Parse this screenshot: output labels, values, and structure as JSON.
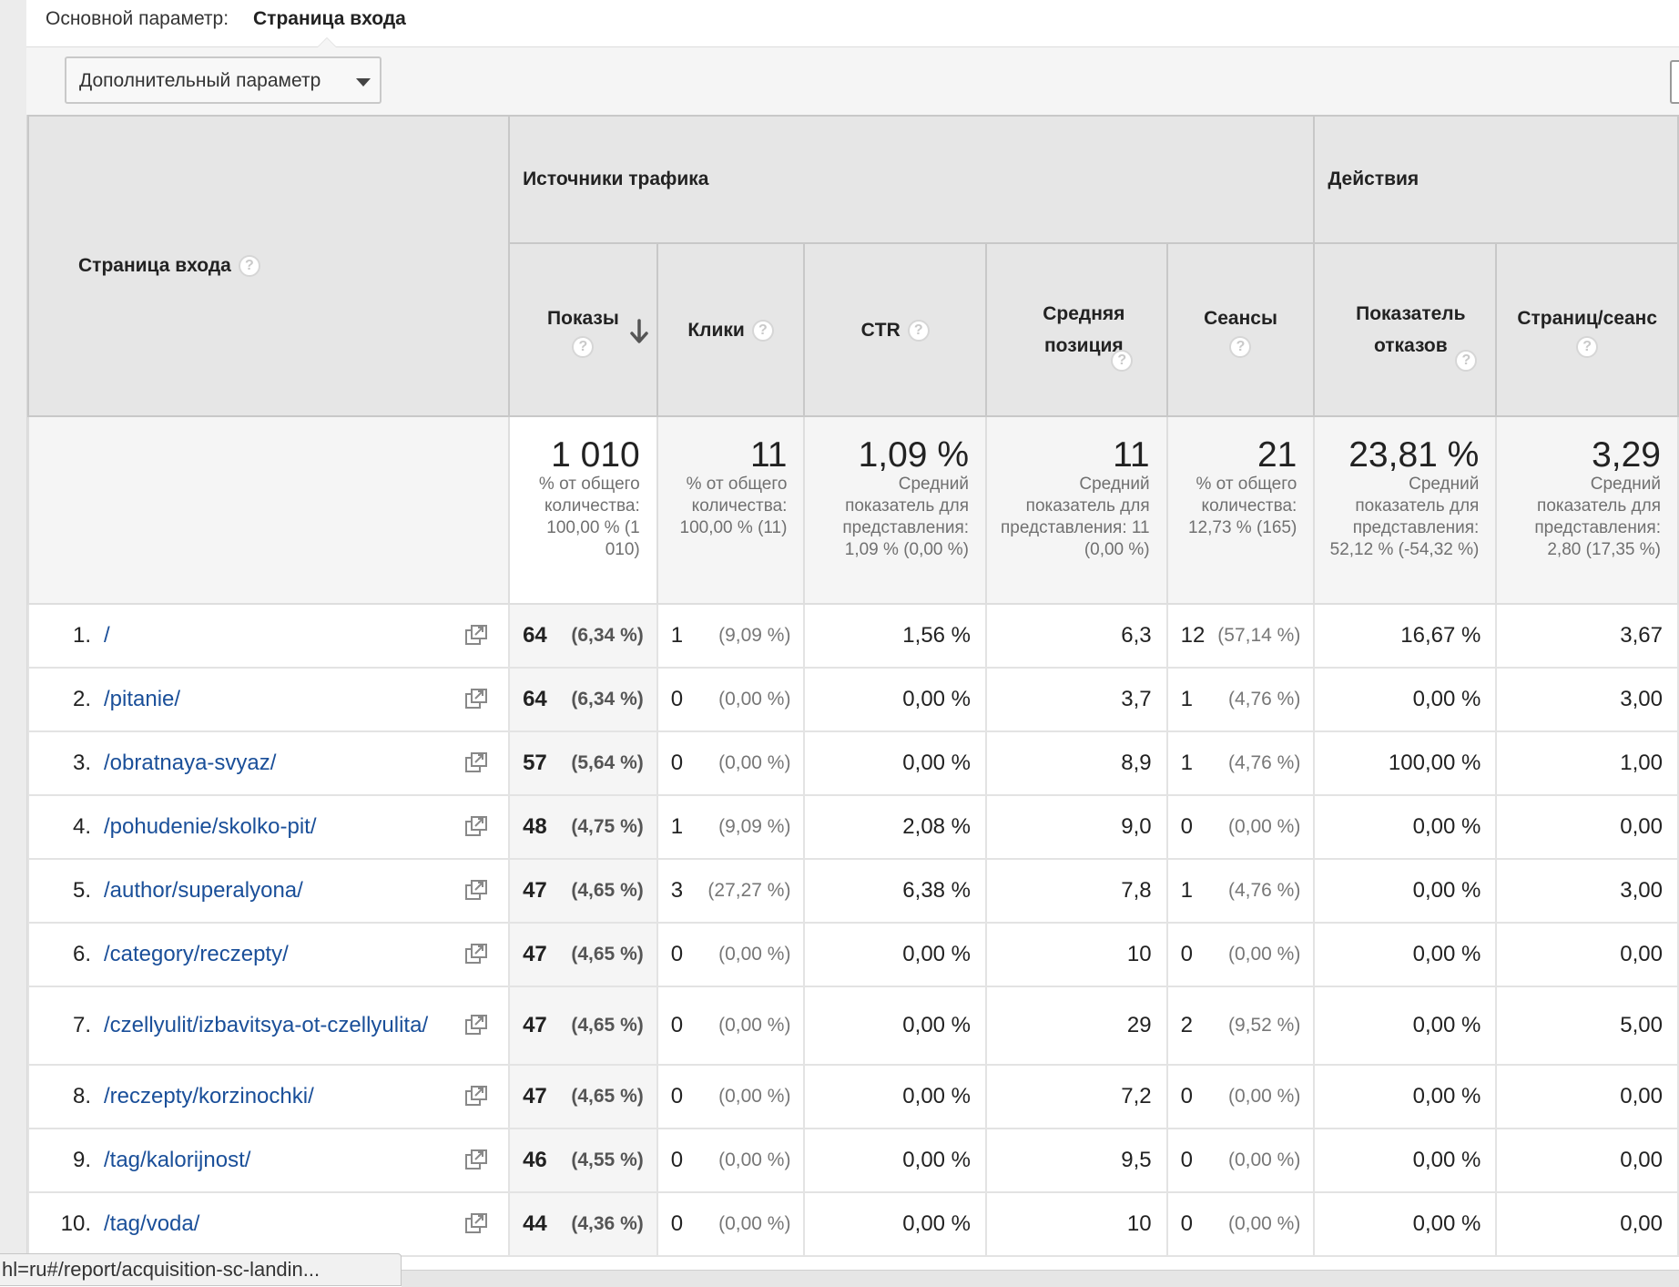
{
  "primary_dimension": {
    "label": "Основной параметр:",
    "value": "Страница входа"
  },
  "secondary_dimension": {
    "label": "Дополнительный параметр"
  },
  "header": {
    "dimension": "Страница входа",
    "groups": [
      {
        "label": "Источники трафика"
      },
      {
        "label": "Действия"
      }
    ],
    "columns": [
      {
        "label": "Показы"
      },
      {
        "label": "Клики"
      },
      {
        "label": "CTR"
      },
      {
        "label": "Средняя позиция"
      },
      {
        "label": "Сеансы"
      },
      {
        "label": "Показатель отказов"
      },
      {
        "label": "Страниц/сеанс"
      }
    ],
    "help_glyph": "?"
  },
  "totals": [
    {
      "value": "1 010",
      "sub": "% от общего количества: 100,00 % (1 010)"
    },
    {
      "value": "11",
      "sub": "% от общего количества: 100,00 % (11)"
    },
    {
      "value": "1,09 %",
      "sub": "Средний показатель для представления: 1,09 % (0,00 %)"
    },
    {
      "value": "11",
      "sub": "Средний показатель для представления: 11 (0,00 %)"
    },
    {
      "value": "21",
      "sub": "% от общего количества: 12,73 % (165)"
    },
    {
      "value": "23,81 %",
      "sub": "Средний показатель для представления: 52,12 % (-54,32 %)"
    },
    {
      "value": "3,29",
      "sub": "Средний показатель для представления: 2,80 (17,35 %)"
    }
  ],
  "rows": [
    {
      "idx": "1.",
      "path": "/",
      "impr": "64",
      "impr_pct": "(6,34 %)",
      "clicks": "1",
      "clicks_pct": "(9,09 %)",
      "ctr": "1,56 %",
      "pos": "6,3",
      "sessions": "12",
      "sessions_pct": "(57,14 %)",
      "bounce": "16,67 %",
      "pps": "3,67"
    },
    {
      "idx": "2.",
      "path": "/pitanie/",
      "impr": "64",
      "impr_pct": "(6,34 %)",
      "clicks": "0",
      "clicks_pct": "(0,00 %)",
      "ctr": "0,00 %",
      "pos": "3,7",
      "sessions": "1",
      "sessions_pct": "(4,76 %)",
      "bounce": "0,00 %",
      "pps": "3,00"
    },
    {
      "idx": "3.",
      "path": "/obratnaya-svyaz/",
      "impr": "57",
      "impr_pct": "(5,64 %)",
      "clicks": "0",
      "clicks_pct": "(0,00 %)",
      "ctr": "0,00 %",
      "pos": "8,9",
      "sessions": "1",
      "sessions_pct": "(4,76 %)",
      "bounce": "100,00 %",
      "pps": "1,00"
    },
    {
      "idx": "4.",
      "path": "/pohudenie/skolko-pit/",
      "impr": "48",
      "impr_pct": "(4,75 %)",
      "clicks": "1",
      "clicks_pct": "(9,09 %)",
      "ctr": "2,08 %",
      "pos": "9,0",
      "sessions": "0",
      "sessions_pct": "(0,00 %)",
      "bounce": "0,00 %",
      "pps": "0,00"
    },
    {
      "idx": "5.",
      "path": "/author/superalyona/",
      "impr": "47",
      "impr_pct": "(4,65 %)",
      "clicks": "3",
      "clicks_pct": "(27,27 %)",
      "ctr": "6,38 %",
      "pos": "7,8",
      "sessions": "1",
      "sessions_pct": "(4,76 %)",
      "bounce": "0,00 %",
      "pps": "3,00"
    },
    {
      "idx": "6.",
      "path": "/category/reczepty/",
      "impr": "47",
      "impr_pct": "(4,65 %)",
      "clicks": "0",
      "clicks_pct": "(0,00 %)",
      "ctr": "0,00 %",
      "pos": "10",
      "sessions": "0",
      "sessions_pct": "(0,00 %)",
      "bounce": "0,00 %",
      "pps": "0,00"
    },
    {
      "idx": "7.",
      "path": "/czellyulit/izbavitsya-ot-czellyulita/",
      "impr": "47",
      "impr_pct": "(4,65 %)",
      "clicks": "0",
      "clicks_pct": "(0,00 %)",
      "ctr": "0,00 %",
      "pos": "29",
      "sessions": "2",
      "sessions_pct": "(9,52 %)",
      "bounce": "0,00 %",
      "pps": "5,00"
    },
    {
      "idx": "8.",
      "path": "/reczepty/korzinochki/",
      "impr": "47",
      "impr_pct": "(4,65 %)",
      "clicks": "0",
      "clicks_pct": "(0,00 %)",
      "ctr": "0,00 %",
      "pos": "7,2",
      "sessions": "0",
      "sessions_pct": "(0,00 %)",
      "bounce": "0,00 %",
      "pps": "0,00"
    },
    {
      "idx": "9.",
      "path": "/tag/kalorijnost/",
      "impr": "46",
      "impr_pct": "(4,55 %)",
      "clicks": "0",
      "clicks_pct": "(0,00 %)",
      "ctr": "0,00 %",
      "pos": "9,5",
      "sessions": "0",
      "sessions_pct": "(0,00 %)",
      "bounce": "0,00 %",
      "pps": "0,00"
    },
    {
      "idx": "10.",
      "path": "/tag/voda/",
      "impr": "44",
      "impr_pct": "(4,36 %)",
      "clicks": "0",
      "clicks_pct": "(0,00 %)",
      "ctr": "0,00 %",
      "pos": "10",
      "sessions": "0",
      "sessions_pct": "(0,00 %)",
      "bounce": "0,00 %",
      "pps": "0,00"
    }
  ],
  "status_url": "hl=ru#/report/acquisition-sc-landin...",
  "colors": {
    "link": "#1a4f99",
    "header_bg": "#e6e6e6",
    "sorted_bg": "#f5f5f5"
  },
  "icons": {
    "external": "open-in-new-window-icon",
    "help": "help-circle-icon",
    "sort": "sort-desc-arrow-icon"
  }
}
